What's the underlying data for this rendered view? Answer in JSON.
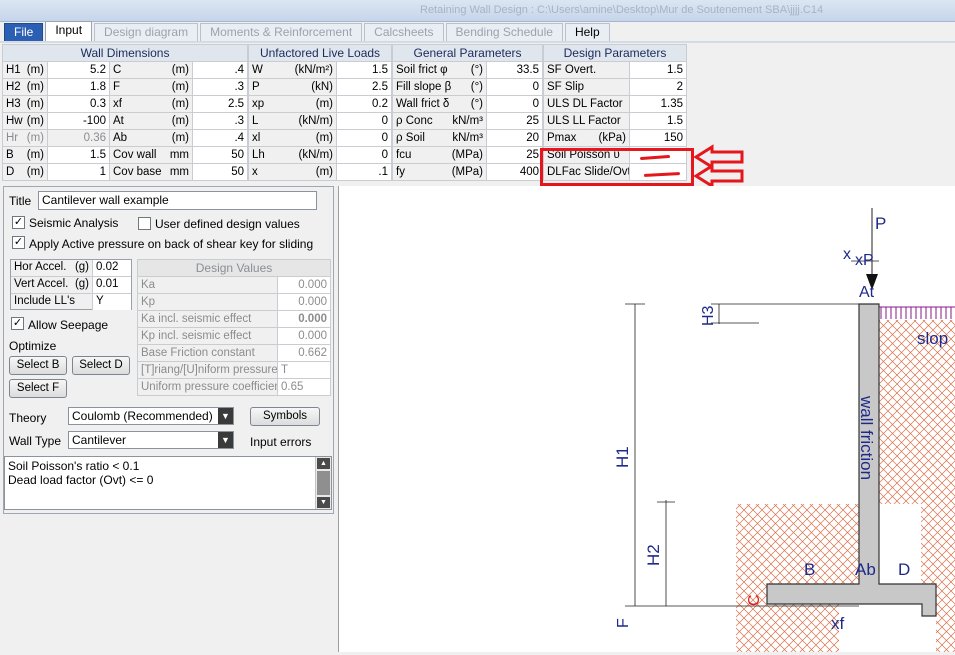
{
  "window_title": "Retaining Wall Design :  C:\\Users\\amine\\Desktop\\Mur de Soutenement SBA\\jjjj.C14",
  "menu": [
    "File",
    "Input",
    "Design diagram",
    "Moments & Reinforcement",
    "Calcsheets",
    "Bending Schedule",
    "Help"
  ],
  "tables": {
    "wall_dimensions": {
      "title": "Wall Dimensions",
      "rows": [
        {
          "l1": "H1",
          "u1": "(m)",
          "v1": "5.2",
          "l2": "C",
          "u2": "(m)",
          "v2": ".4"
        },
        {
          "l1": "H2",
          "u1": "(m)",
          "v1": "1.8",
          "l2": "F",
          "u2": "(m)",
          "v2": ".3"
        },
        {
          "l1": "H3",
          "u1": "(m)",
          "v1": "0.3",
          "l2": "xf",
          "u2": "(m)",
          "v2": "2.5"
        },
        {
          "l1": "Hw",
          "u1": "(m)",
          "v1": "-100",
          "l2": "At",
          "u2": "(m)",
          "v2": ".3"
        },
        {
          "l1": "Hr",
          "u1": "(m)",
          "v1": "0.36",
          "l2": "Ab",
          "u2": "(m)",
          "v2": ".4"
        },
        {
          "l1": "B",
          "u1": "(m)",
          "v1": "1.5",
          "l2": "Cov wall",
          "u2": "mm",
          "v2": "50"
        },
        {
          "l1": "D",
          "u1": "(m)",
          "v1": "1",
          "l2": "Cov base",
          "u2": "mm",
          "v2": "50"
        }
      ]
    },
    "unfactored_live_loads": {
      "title": "Unfactored Live Loads",
      "rows": [
        {
          "l": "W",
          "u": "(kN/m²)",
          "v": "1.5"
        },
        {
          "l": "P",
          "u": "(kN)",
          "v": "2.5"
        },
        {
          "l": "xp",
          "u": "(m)",
          "v": "0.2"
        },
        {
          "l": "L",
          "u": "(kN/m)",
          "v": "0"
        },
        {
          "l": "xl",
          "u": "(m)",
          "v": "0"
        },
        {
          "l": "Lh",
          "u": "(kN/m)",
          "v": "0"
        },
        {
          "l": "x",
          "u": "(m)",
          "v": ".1"
        }
      ]
    },
    "general_parameters": {
      "title": "General Parameters",
      "rows": [
        {
          "l": "Soil frict φ",
          "u": "(°)",
          "v": "33.5"
        },
        {
          "l": "Fill slope β",
          "u": "(°)",
          "v": "0"
        },
        {
          "l": "Wall frict δ",
          "u": "(°)",
          "v": "0"
        },
        {
          "l": "ρ Conc",
          "u": "kN/m³",
          "v": "25"
        },
        {
          "l": "ρ Soil",
          "u": "kN/m³",
          "v": "20"
        },
        {
          "l": "fcu",
          "u": "(MPa)",
          "v": "25"
        },
        {
          "l": "fy",
          "u": "(MPa)",
          "v": "400"
        }
      ]
    },
    "design_parameters": {
      "title": "Design Parameters",
      "rows": [
        {
          "l": "SF Overt.",
          "u": "",
          "v": "1.5"
        },
        {
          "l": "SF Slip",
          "u": "",
          "v": "2"
        },
        {
          "l": "ULS DL Factor",
          "u": "",
          "v": "1.35"
        },
        {
          "l": "ULS LL Factor",
          "u": "",
          "v": "1.5"
        },
        {
          "l": "Pmax",
          "u": "(kPa)",
          "v": "150"
        },
        {
          "l": "Soil Poisson υ",
          "u": "",
          "v": ""
        },
        {
          "l": "DLFac Slide/Ovt",
          "u": "",
          "v": ""
        }
      ]
    }
  },
  "form": {
    "title_label": "Title",
    "title_value": "Cantilever wall example",
    "seismic_label": "Seismic Analysis",
    "user_defined_label": "User defined design values",
    "active_pressure_label": "Apply Active pressure on back of shear key for sliding",
    "hor_accel_label": "Hor Accel.",
    "hor_accel_unit": "(g)",
    "hor_accel_value": "0.02",
    "vert_accel_label": "Vert Accel.",
    "vert_accel_unit": "(g)",
    "vert_accel_value": "0.01",
    "include_ll_label": "Include LL's",
    "include_ll_value": "Y",
    "allow_seepage_label": "Allow Seepage",
    "optimize_label": "Optimize",
    "select_b": "Select B",
    "select_d": "Select D",
    "select_f": "Select F",
    "design_values_title": "Design Values",
    "design_values": [
      {
        "label": "Ka",
        "value": "0.000"
      },
      {
        "label": "Kp",
        "value": "0.000"
      },
      {
        "label": "Ka incl. seismic effect",
        "value": "0.000"
      },
      {
        "label": "Kp incl. seismic effect",
        "value": "0.000"
      },
      {
        "label": "Base Friction constant",
        "value": "0.662"
      },
      {
        "label": "[T]riang/[U]niform pressure",
        "value": "T"
      },
      {
        "label": "Uniform pressure coefficien",
        "value": "0.65"
      }
    ],
    "theory_label": "Theory",
    "theory_value": "Coulomb (Recommended)",
    "symbols_button": "Symbols",
    "wall_type_label": "Wall Type",
    "wall_type_value": "Cantilever",
    "input_errors_label": "Input errors",
    "errors": [
      "Soil Poisson's ratio < 0.1",
      "Dead load factor (Ovt) <= 0"
    ]
  },
  "diagram": {
    "labels": {
      "P": "P",
      "x": "x",
      "xP": "xP",
      "At": "At",
      "H3": "H3",
      "H1": "H1",
      "H2": "H2",
      "F": "F",
      "C": "C",
      "B": "B",
      "Ab": "Ab",
      "D": "D",
      "xf": "xf",
      "wall_friction": "wall friction",
      "slope": "slop"
    },
    "colors": {
      "labels": "#1e2a8a",
      "red_label": "#e01818",
      "wall_fill": "#c8c8c8",
      "soil_hatch": "#d9704a",
      "highlight": "#e5161c"
    }
  }
}
